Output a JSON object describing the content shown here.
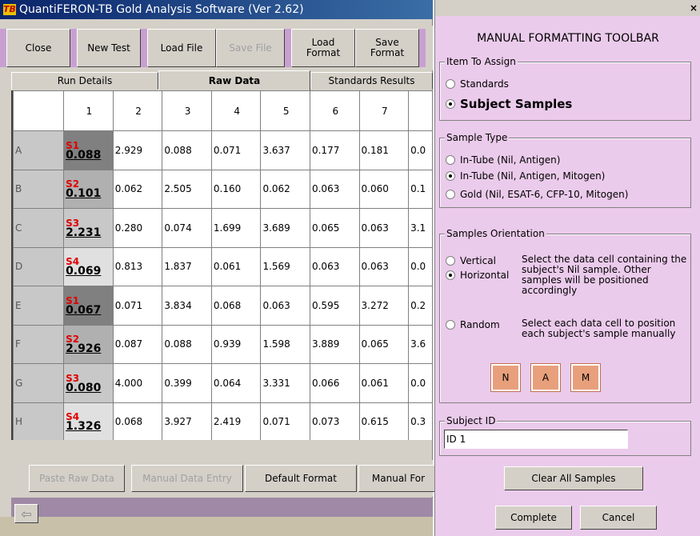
{
  "window": {
    "title": "QuantiFERON-TB Gold Analysis Software (Ver 2.62)",
    "logo": "TB"
  },
  "toolbar": {
    "close": "Close",
    "new_test": "New Test",
    "load_file": "Load File",
    "save_file": "Save File",
    "load_format": "Load Format",
    "save_format": "Save Format"
  },
  "tabs": [
    {
      "label": "Run Details"
    },
    {
      "label": "Raw Data"
    },
    {
      "label": "Standards Results"
    }
  ],
  "grid": {
    "columns": [
      "1",
      "2",
      "3",
      "4",
      "5",
      "6",
      "7",
      ""
    ],
    "rows": [
      {
        "label": "A",
        "sid": "S1",
        "v1": "0.088",
        "vals": [
          "2.929",
          "0.088",
          "0.071",
          "3.637",
          "0.177",
          "0.181",
          "0.0"
        ]
      },
      {
        "label": "B",
        "sid": "S2",
        "v1": "0.101",
        "vals": [
          "0.062",
          "2.505",
          "0.160",
          "0.062",
          "0.063",
          "0.060",
          "0.1"
        ]
      },
      {
        "label": "C",
        "sid": "S3",
        "v1": "2.231",
        "vals": [
          "0.280",
          "0.074",
          "1.699",
          "3.689",
          "0.065",
          "0.063",
          "3.1"
        ]
      },
      {
        "label": "D",
        "sid": "S4",
        "v1": "0.069",
        "vals": [
          "0.813",
          "1.837",
          "0.061",
          "1.569",
          "0.063",
          "0.063",
          "0.0"
        ]
      },
      {
        "label": "E",
        "sid": "S1",
        "v1": "0.067",
        "vals": [
          "0.071",
          "3.834",
          "0.068",
          "0.063",
          "0.595",
          "3.272",
          "0.2"
        ]
      },
      {
        "label": "F",
        "sid": "S2",
        "v1": "2.926",
        "vals": [
          "0.087",
          "0.088",
          "0.939",
          "1.598",
          "3.889",
          "0.065",
          "3.6"
        ]
      },
      {
        "label": "G",
        "sid": "S3",
        "v1": "0.080",
        "vals": [
          "4.000",
          "0.399",
          "0.064",
          "3.331",
          "0.066",
          "0.061",
          "0.0"
        ]
      },
      {
        "label": "H",
        "sid": "S4",
        "v1": "1.326",
        "vals": [
          "0.068",
          "3.927",
          "2.419",
          "0.071",
          "0.073",
          "0.615",
          "0.3"
        ]
      }
    ],
    "cell1_colors": [
      "#808080",
      "#b0b0b0",
      "#c8c8c8",
      "#e0e0e0",
      "#808080",
      "#b0b0b0",
      "#c8c8c8",
      "#e0e0e0"
    ]
  },
  "bottom": {
    "paste_raw": "Paste Raw Data",
    "manual_entry": "Manual Data Entry",
    "default_format": "Default Format",
    "manual_format": "Manual For"
  },
  "panel": {
    "title": "MANUAL FORMATTING TOOLBAR",
    "close_glyph": "×",
    "item_group": "Item To Assign",
    "item_standards": "Standards",
    "item_subject": "Subject Samples",
    "type_group": "Sample Type",
    "type_1": "In-Tube (Nil, Antigen)",
    "type_2": "In-Tube (Nil, Antigen, Mitogen)",
    "type_3": "Gold (Nil, ESAT-6, CFP-10, Mitogen)",
    "orient_group": "Samples Orientation",
    "orient_vertical": "Vertical",
    "orient_horizontal": "Horizontal",
    "orient_desc": "Select the data cell containing the subject's Nil sample. Other samples will be positioned accordingly",
    "orient_random": "Random",
    "random_desc": "Select each data cell to position each subject's sample manually",
    "n": "N",
    "a": "A",
    "m": "M",
    "subject_group": "Subject ID",
    "subject_value": "ID 1",
    "clear_all": "Clear All Samples",
    "complete": "Complete",
    "cancel": "Cancel"
  }
}
